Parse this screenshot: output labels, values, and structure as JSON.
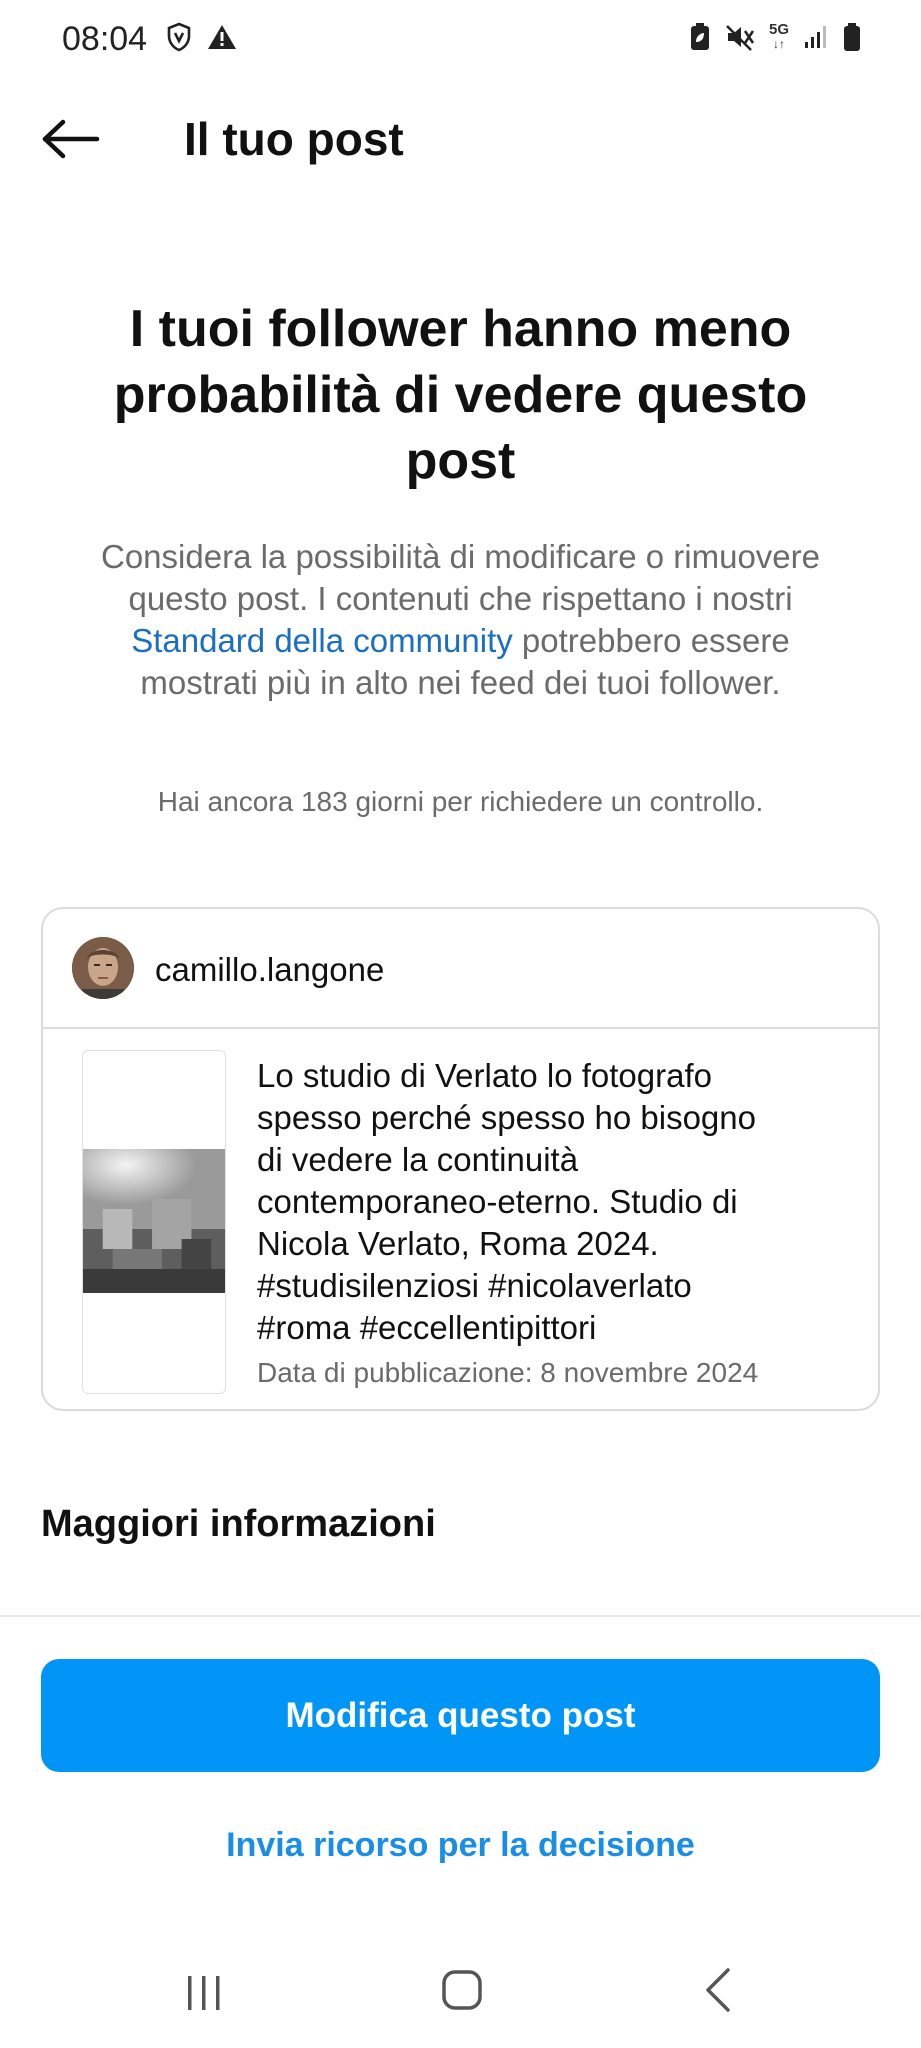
{
  "status_bar": {
    "time": "08:04",
    "network": "5G"
  },
  "header": {
    "title": "Il tuo post"
  },
  "headline": "I tuoi follower hanno meno probabilità di vedere questo post",
  "description": {
    "before_link": "Considera la possibilità di modificare o rimuovere questo post. I contenuti che rispettano i nostri ",
    "link": "Standard della community",
    "after_link": " potrebbero essere mostrati più in alto nei feed dei tuoi follower."
  },
  "review_note": "Hai ancora 183 giorni per richiedere un controllo.",
  "post": {
    "username": "camillo.langone",
    "caption": "Lo studio di Verlato lo fotografo spesso perché spesso ho bisogno di vedere la continuità contemporaneo-eterno. Studio di Nicola Verlato, Roma 2024. #studisilenziosi #nicolaverlato #roma #eccellentipittori",
    "date": "Data di pubblicazione: 8 novembre 2024"
  },
  "more_info": "Maggiori informazioni",
  "primary_button": "Modifica questo post",
  "secondary_link": "Invia ricorso per la decisione",
  "colors": {
    "accent": "#0095f6",
    "link": "#1a6ec3",
    "secondary_text": "#6b6b6b",
    "border": "#dbdbdb"
  }
}
